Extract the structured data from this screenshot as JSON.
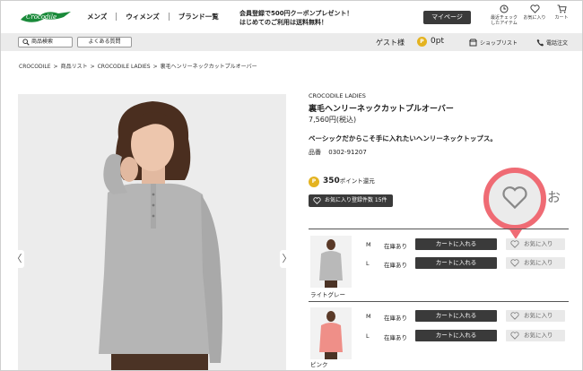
{
  "header": {
    "logo_text": "Crocodile",
    "nav": [
      "メンズ",
      "ウィメンズ",
      "ブランド一覧"
    ],
    "promo_line1": "会員登録で500円クーポンプレゼント！",
    "promo_line2": "はじめてのご利用は送料無料！",
    "mypage": "マイページ",
    "recent_line1": "最近チェック",
    "recent_line2": "したアイテム",
    "favorites": "お気に入り",
    "cart": "カート"
  },
  "subbar": {
    "search_button": "商品検索",
    "faq_button": "よくある質問",
    "guest": "ゲスト様",
    "coin_glyph": "P",
    "points": "0pt",
    "shop_list": "ショップリスト",
    "phone_order": "電話注文"
  },
  "breadcrumb": [
    "CROCODILE",
    "商品リスト",
    "CROCODILE LADIES",
    "裏毛ヘンリーネックカットプルオーバー"
  ],
  "breadcrumb_sep": ">",
  "product": {
    "brand": "CROCODILE LADIES",
    "name": "裏毛ヘンリーネックカットプルオーバー",
    "price": "7,560円(税込)",
    "catch_copy": "ベーシックだからこそ手に入れたいヘンリーネックトップス。",
    "code_label": "品番",
    "code": "0302-91207",
    "points_value": "350",
    "points_suffix": "ポイント還元",
    "fav_count_label": "お気に入り登録件数 15件",
    "partial_text": "お"
  },
  "gallery": {
    "prev": "〈",
    "next": "〉"
  },
  "variants": [
    {
      "color": "ライトグレー",
      "sizes": [
        {
          "size": "M",
          "stock": "在庫あり",
          "cart": "カートに入れる",
          "fav": "お気に入り"
        },
        {
          "size": "L",
          "stock": "在庫あり",
          "cart": "カートに入れる",
          "fav": "お気に入り"
        }
      ]
    },
    {
      "color": "ピンク",
      "sizes": [
        {
          "size": "M",
          "stock": "在庫あり",
          "cart": "カートに入れる",
          "fav": "お気に入り"
        },
        {
          "size": "L",
          "stock": "在庫あり",
          "cart": "カートに入れる",
          "fav": "お気に入り"
        }
      ]
    }
  ],
  "colors": {
    "accent_red": "#ef6b74",
    "dark_button": "#3a3a3a",
    "logo_green": "#1a8a3a",
    "coin": "#e4b320"
  }
}
